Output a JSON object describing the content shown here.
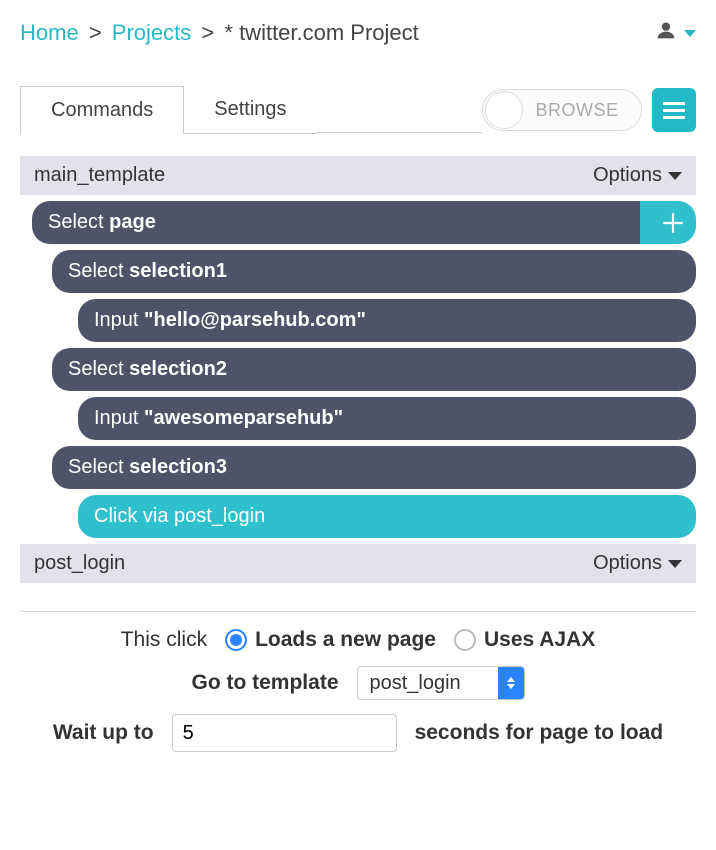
{
  "breadcrumb": {
    "home": "Home",
    "projects": "Projects",
    "current": "* twitter.com Project",
    "sep": ">"
  },
  "tabs": {
    "commands": "Commands",
    "settings": "Settings"
  },
  "browse": {
    "label": "BROWSE"
  },
  "templates": {
    "main": {
      "name": "main_template",
      "options": "Options"
    },
    "post": {
      "name": "post_login",
      "options": "Options"
    }
  },
  "commands": {
    "select_page": {
      "verb": "Select",
      "target": "page"
    },
    "sel1": {
      "verb": "Select",
      "target": "selection1"
    },
    "input1": {
      "verb": "Input",
      "value": "\"hello@parsehub.com\""
    },
    "sel2": {
      "verb": "Select",
      "target": "selection2"
    },
    "input2": {
      "verb": "Input",
      "value": "\"awesomeparsehub\""
    },
    "sel3": {
      "verb": "Select",
      "target": "selection3"
    },
    "click": {
      "label": "Click via post_login"
    }
  },
  "config": {
    "this_click": "This click",
    "loads_new_page": "Loads a new page",
    "uses_ajax": "Uses AJAX",
    "go_to_template": "Go to template",
    "template_selected": "post_login",
    "wait_up_to": "Wait up to",
    "wait_value": "5",
    "wait_suffix": "seconds for page to load"
  }
}
